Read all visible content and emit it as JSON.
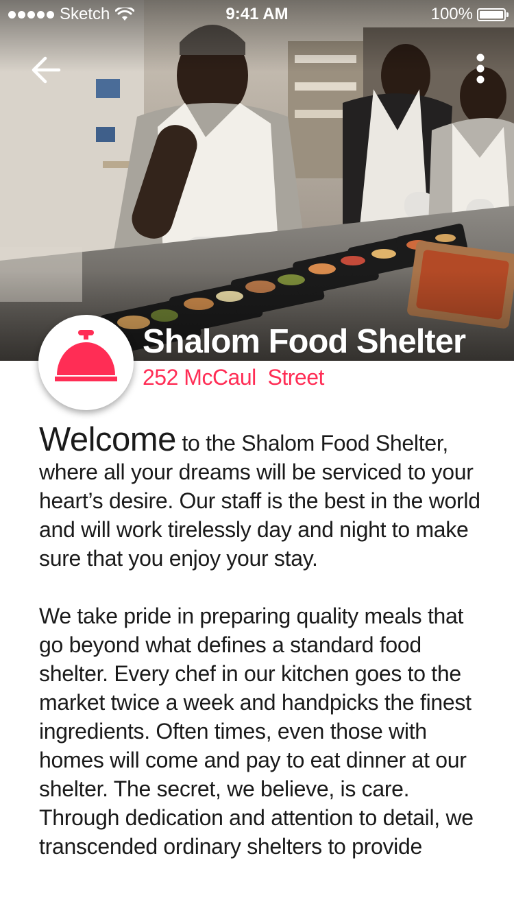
{
  "status_bar": {
    "carrier": "Sketch",
    "time": "9:41 AM",
    "battery_percent": "100%",
    "icons": [
      "signal-dots-icon",
      "wifi-icon",
      "battery-icon"
    ]
  },
  "nav": {
    "back_icon": "arrow-left-icon",
    "more_icon": "vertical-ellipsis-icon"
  },
  "header": {
    "logo_icon": "serving-bell-icon",
    "name": "Shalom Food Shelter",
    "address": "252 McCaul  Street"
  },
  "description": {
    "welcome_word": "Welcome",
    "intro_rest": " to the Shalom Food Shelter, where all your dreams will be serviced to your heart’s desire. Our staff is the best in the world and will work tirelessly day and night to make sure that you enjoy your stay.",
    "paragraph_2": "We take pride in preparing quality meals that go beyond what defines a standard food shelter. Every chef in our kitchen goes to the market twice a week and handpicks the finest ingredients. Often times, even those with homes will come and pay to eat dinner at our shelter. The secret, we believe, is care. Through dedication and attention to detail, we transcended ordinary shelters to provide"
  },
  "colors": {
    "accent": "#ff2d55",
    "text": "#1a1a1a",
    "background": "#ffffff"
  }
}
